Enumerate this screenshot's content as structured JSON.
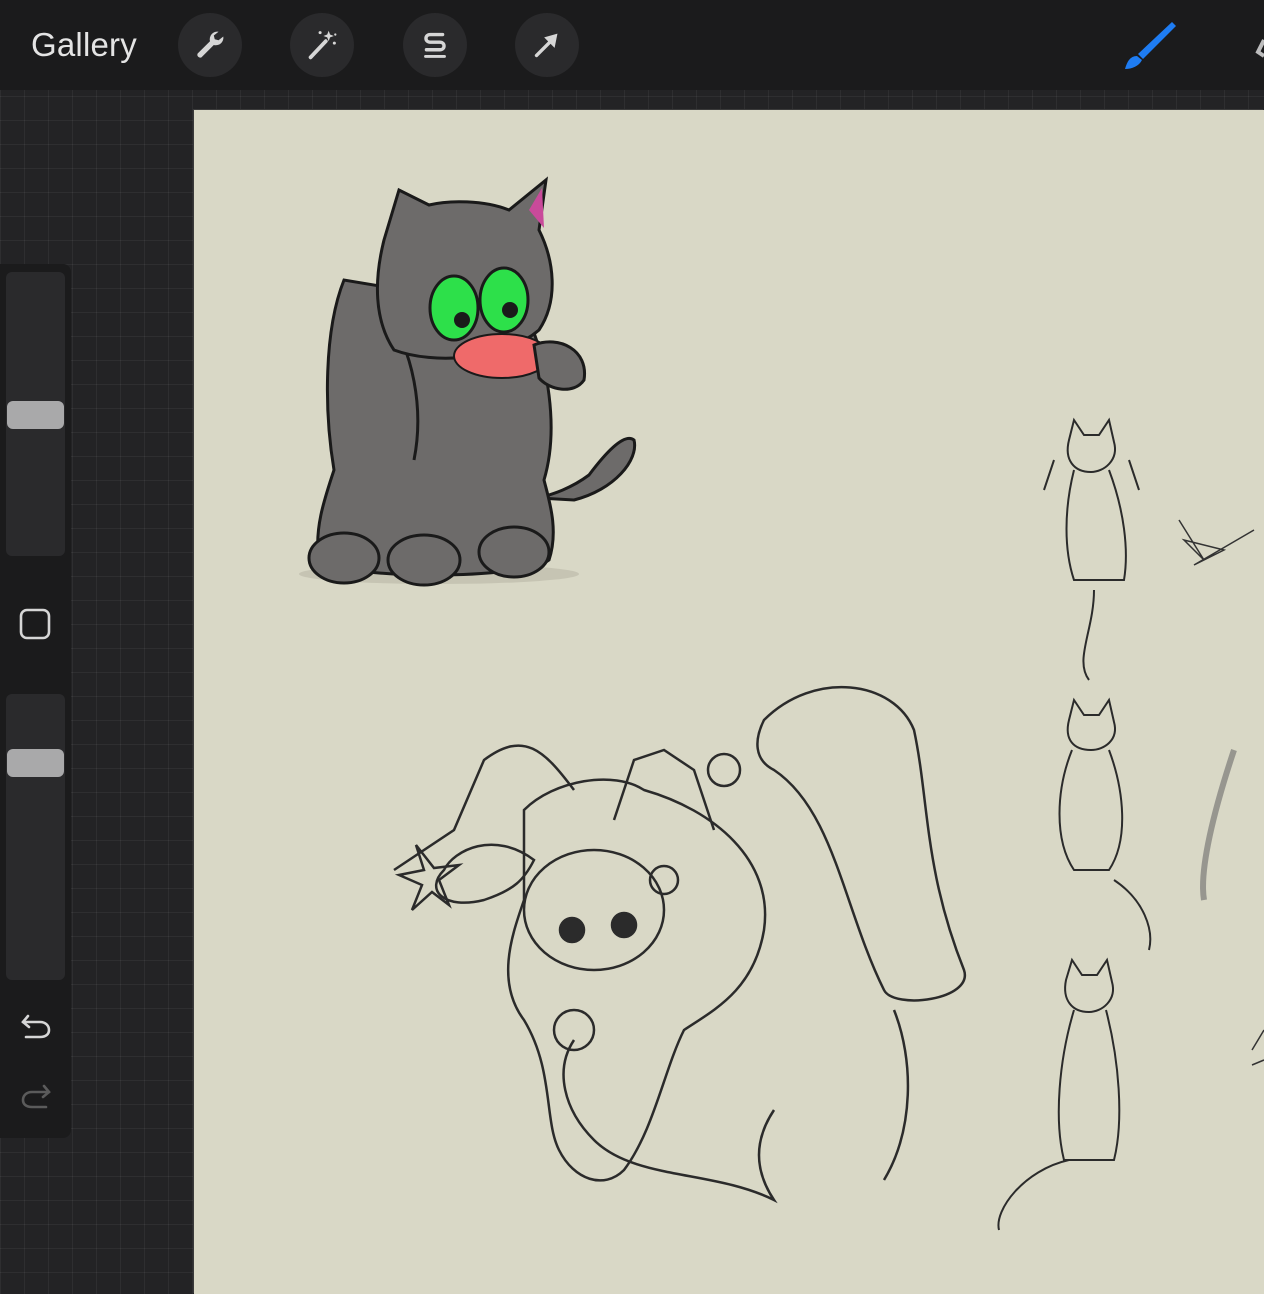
{
  "toolbar": {
    "gallery_label": "Gallery",
    "tools": [
      {
        "icon": "wrench-icon",
        "name": "actions"
      },
      {
        "icon": "magic-wand-icon",
        "name": "adjustments"
      },
      {
        "icon": "selection-s-icon",
        "name": "selection"
      },
      {
        "icon": "arrow-cursor-icon",
        "name": "transform"
      }
    ],
    "brush_icon": "brush-icon",
    "brush_color": "#1e7cf2"
  },
  "sidebar": {
    "brush_size_level": 0.5,
    "opacity_level": 0.25,
    "modify_icon": "square-outline-icon",
    "undo_icon": "undo-icon",
    "redo_icon": "redo-icon"
  },
  "canvas": {
    "background_color": "#d9d8c6",
    "artwork": [
      "colored-gray-cat",
      "jester-cat-sketch",
      "cat-sketch-upside-down",
      "cat-sketch-lying",
      "cat-sketch-climbing",
      "scribble-marks"
    ]
  },
  "colors": {
    "toolbar_bg": "#1b1b1c",
    "button_bg": "#2a2a2c",
    "icon": "#d6d6d6",
    "cat_body": "#6d6b6a",
    "cat_eyes": "#2de04a",
    "cat_tongue": "#ef6a6a"
  }
}
